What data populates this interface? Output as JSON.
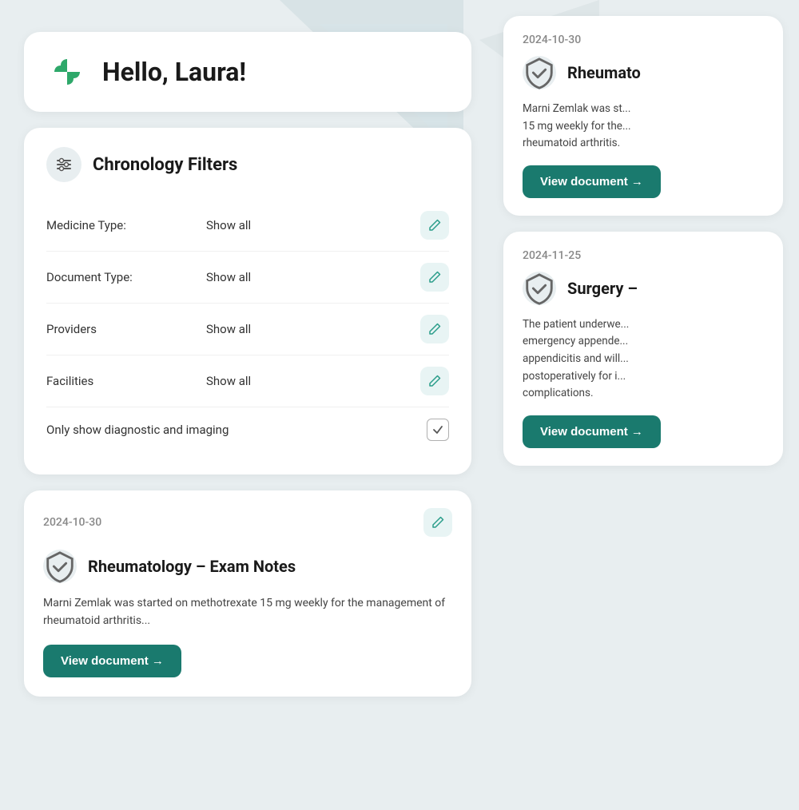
{
  "background": {
    "color": "#e0e8eb"
  },
  "header": {
    "greeting": "Hello, Laura!",
    "logo_alt": "app-logo"
  },
  "filters": {
    "title": "Chronology Filters",
    "icon_label": "filters-icon",
    "rows": [
      {
        "label": "Medicine Type:",
        "value": "Show all"
      },
      {
        "label": "Document Type:",
        "value": "Show all"
      },
      {
        "label": "Providers",
        "value": "Show all"
      },
      {
        "label": "Facilities",
        "value": "Show all"
      }
    ],
    "checkbox_row": {
      "label": "Only show diagnostic and imaging",
      "checked": true
    }
  },
  "doc_card_left": {
    "date": "2024-10-30",
    "title": "Rheumatology – Exam Notes",
    "body": "Marni Zemlak was started on methotrexate 15 mg weekly for the management of rheumatoid arthritis...",
    "view_btn": "View document →"
  },
  "right_cards": [
    {
      "date": "2024-10-30",
      "title": "Rheumato",
      "body": "Marni Zemlak was st... 15 mg weekly for the... rheumatoid arthritis.",
      "view_btn": "View document →"
    },
    {
      "date": "2024-11-25",
      "title": "Surgery –",
      "body": "The patient underwe... emergency appende... appendicitis and will... postoperatively for i... complications.",
      "view_btn": "View document →"
    }
  ],
  "icons": {
    "edit": "✏",
    "check": "✓",
    "shield": "✓",
    "arrow": "→"
  },
  "colors": {
    "teal": "#1a7a6e",
    "teal_light": "#e8f4f4",
    "icon_bg": "#e8eef0",
    "green_brand": "#3aaa6e"
  }
}
